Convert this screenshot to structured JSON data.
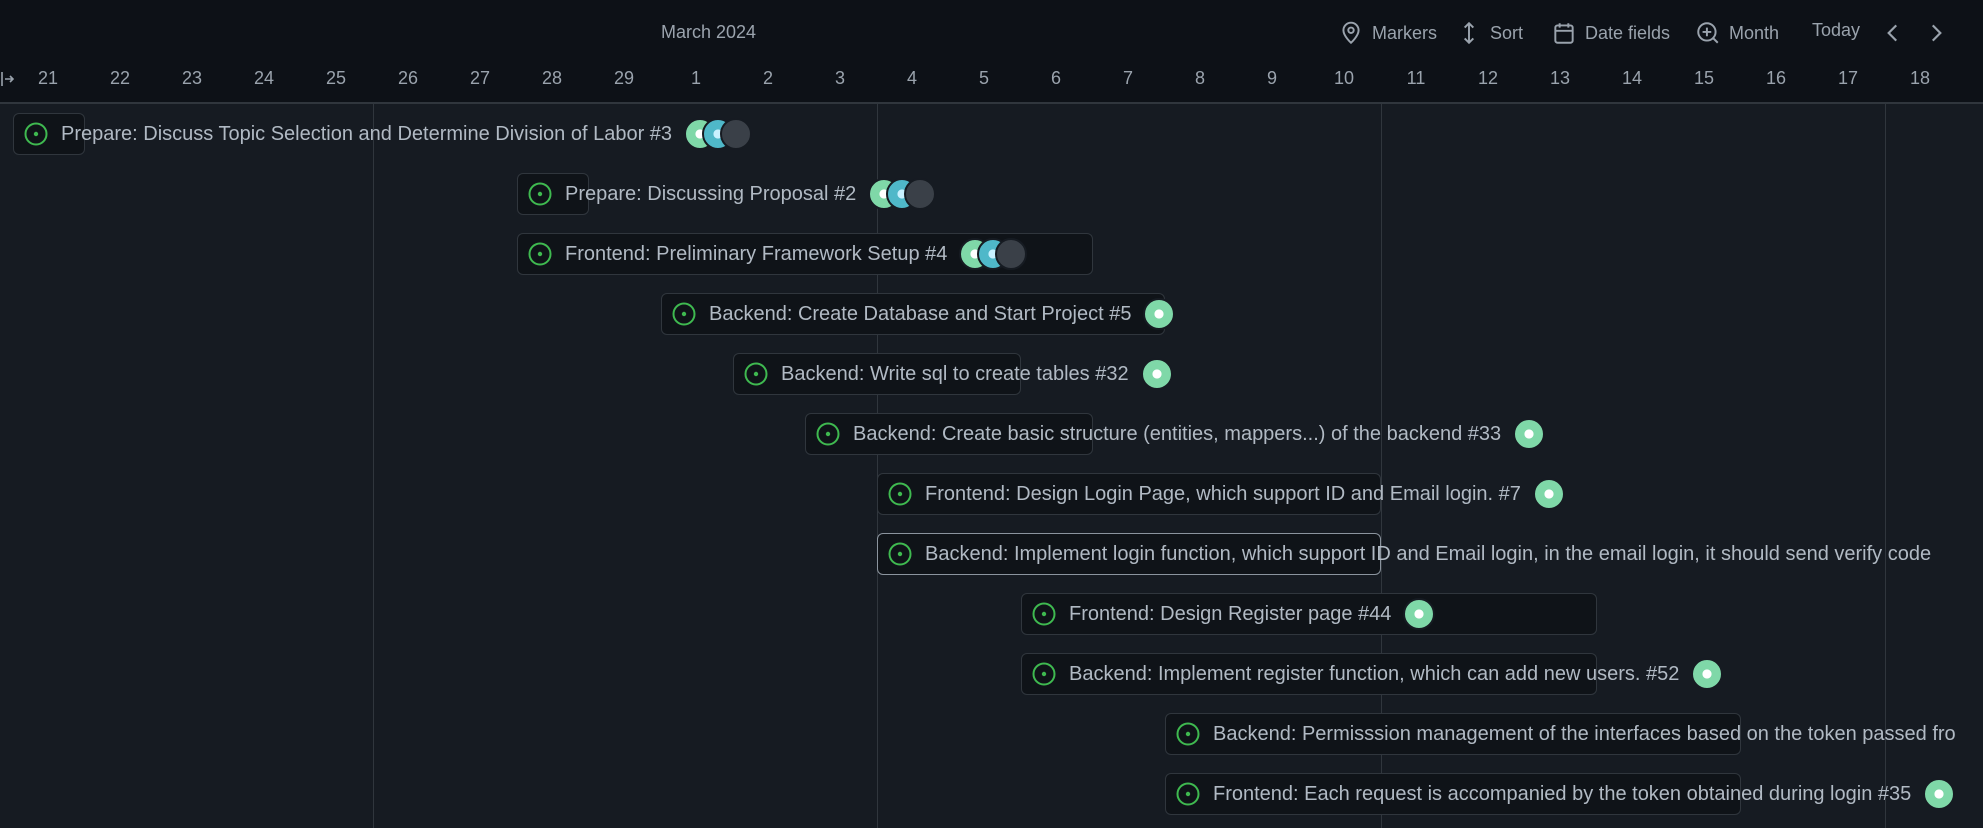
{
  "header": {
    "month": "March 2024",
    "toolbar": {
      "markers": "Markers",
      "sort": "Sort",
      "date_fields": "Date fields",
      "zoom": "Month",
      "today": "Today"
    },
    "days": [
      "21",
      "22",
      "23",
      "24",
      "25",
      "26",
      "27",
      "28",
      "29",
      "1",
      "2",
      "3",
      "4",
      "5",
      "6",
      "7",
      "8",
      "9",
      "10",
      "11",
      "12",
      "13",
      "14",
      "15",
      "16",
      "17",
      "18"
    ]
  },
  "colors": {
    "background": "#161b22",
    "header_background": "#0d1117",
    "status_open": "#3fb950",
    "text": "#b1bac4"
  },
  "icons": {
    "status": "issue-open-icon",
    "markers": "location-pin-icon",
    "sort": "sort-arrows-icon",
    "date_fields": "calendar-icon",
    "zoom": "zoom-in-icon"
  },
  "tasks": [
    {
      "title": "Prepare: Discuss Topic Selection and Determine Division of Labor #3"
    },
    {
      "title": "Prepare: Discussing Proposal #2"
    },
    {
      "title": "Frontend: Preliminary Framework Setup #4"
    },
    {
      "title": "Backend: Create Database and Start Project #5"
    },
    {
      "title": "Backend: Write sql to create tables #32"
    },
    {
      "title": "Backend: Create basic structure (entities, mappers...) of the backend #33"
    },
    {
      "title": "Frontend: Design Login Page, which support ID and Email login. #7"
    },
    {
      "title": "Backend: Implement login function, which support ID and Email login, in the email login, it should send verify code"
    },
    {
      "title": "Frontend: Design Register page #44"
    },
    {
      "title": "Backend: Implement register function, which can add new users. #52"
    },
    {
      "title": "Backend: Permisssion management of the interfaces based on the token passed fro"
    },
    {
      "title": "Frontend: Each request is accompanied by the token obtained during login #35"
    }
  ]
}
